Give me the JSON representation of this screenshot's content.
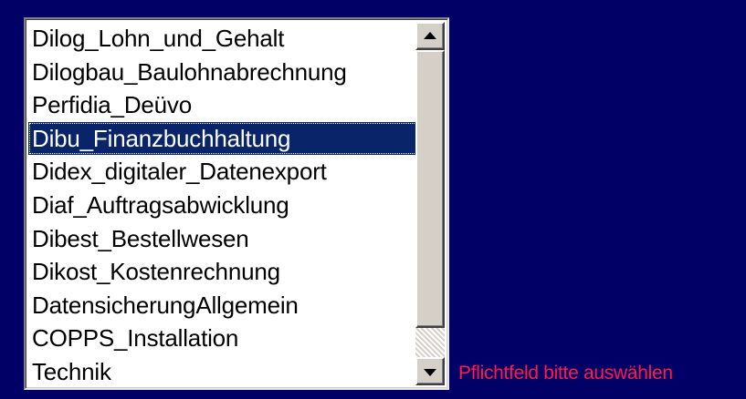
{
  "listbox": {
    "items": [
      {
        "label": "Dilog_Lohn_und_Gehalt"
      },
      {
        "label": "Dilogbau_Baulohnabrechnung"
      },
      {
        "label": "Perfidia_Deüvo"
      },
      {
        "label": "Dibu_Finanzbuchhaltung",
        "selected": true
      },
      {
        "label": "Didex_digitaler_Datenexport"
      },
      {
        "label": "Diaf_Auftragsabwicklung"
      },
      {
        "label": "Dibest_Bestellwesen"
      },
      {
        "label": "Dikost_Kostenrechnung"
      },
      {
        "label": "DatensicherungAllgemein"
      },
      {
        "label": "COPPS_Installation"
      },
      {
        "label": "Technik"
      }
    ],
    "selected_value": "Dibu_Finanzbuchhaltung"
  },
  "validation": {
    "message": "Pflichtfeld bitte auswählen",
    "color": "#ff1a4a"
  },
  "colors": {
    "background": "#000066",
    "selection": "#0a246a"
  },
  "icons": {
    "scroll_up": "scroll-up-arrow-icon",
    "scroll_down": "scroll-down-arrow-icon"
  }
}
